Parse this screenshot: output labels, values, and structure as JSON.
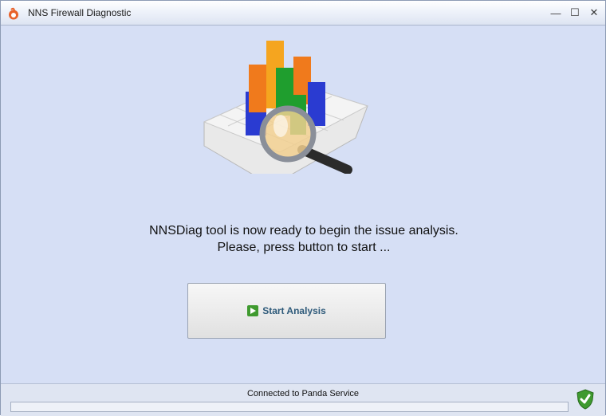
{
  "window": {
    "title": "NNS Firewall Diagnostic",
    "controls": {
      "minimize": "—",
      "maximize": "☐",
      "close": "✕"
    }
  },
  "main": {
    "message_line1": "NNSDiag tool is now ready to begin the issue analysis.",
    "message_line2": "Please, press button to start ...",
    "illustration_icon": "bar-chart-magnifier-icon",
    "start_button": {
      "label": "Start Analysis",
      "icon": "play-icon"
    }
  },
  "status": {
    "text": "Connected to Panda Service",
    "progress": 0,
    "status_icon": "shield-check-icon"
  },
  "colors": {
    "background": "#d6dff5",
    "button_text": "#2e5a7a",
    "play_green": "#3f9a2f"
  }
}
